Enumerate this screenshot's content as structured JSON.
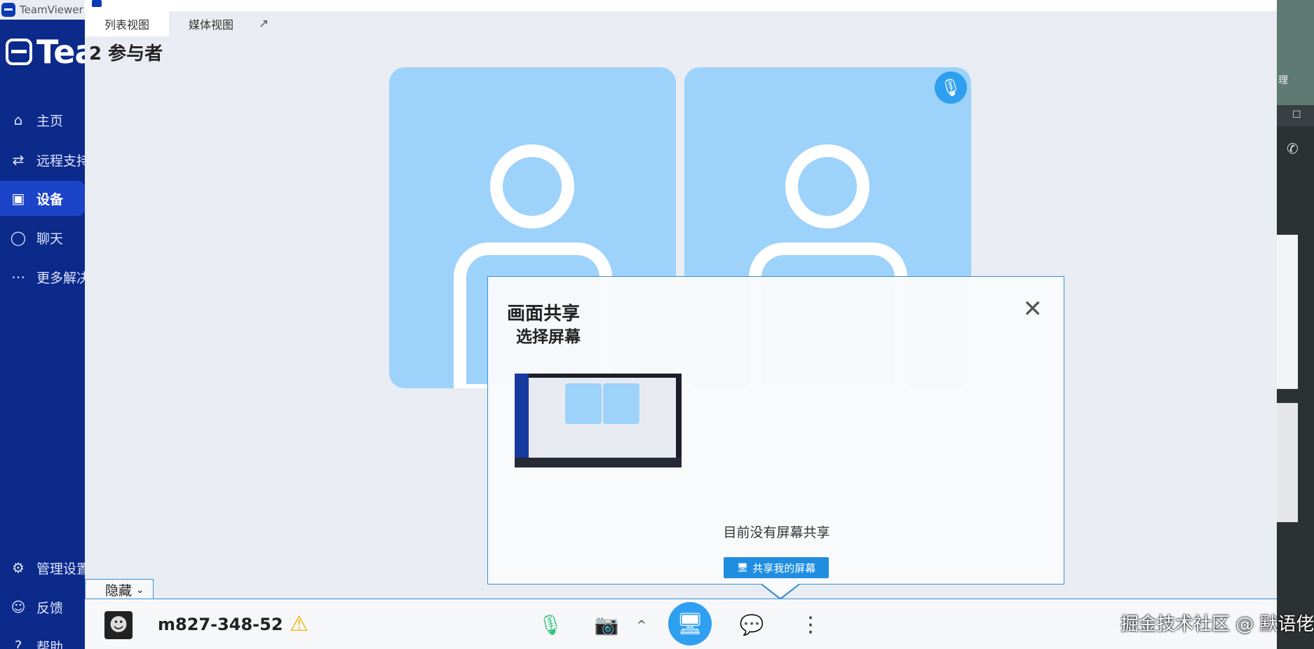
{
  "tv": {
    "title": "TeamViewer",
    "brand": "Tea",
    "nav": [
      {
        "icon": "⌂",
        "label": "主页"
      },
      {
        "icon": "⇄",
        "label": "远程支持"
      },
      {
        "icon": "▣",
        "label": "设备"
      },
      {
        "icon": "◯",
        "label": "聊天"
      },
      {
        "icon": "⋯",
        "label": "更多解决"
      },
      {
        "icon": "⚙",
        "label": "管理设置"
      },
      {
        "icon": "☺",
        "label": "反馈"
      },
      {
        "icon": "?",
        "label": "帮助"
      }
    ]
  },
  "meeting": {
    "tabs": [
      "列表视图",
      "媒体视图"
    ],
    "participants": "2 参与者",
    "hide_label": "隐藏",
    "meeting_id": "m827-348-52"
  },
  "modal": {
    "title": "画面共享",
    "subtitle": "选择屏幕",
    "no_share_text": "目前没有屏幕共享",
    "share_button": "共享我的屏幕"
  },
  "background": {
    "right_text": "理"
  },
  "watermark": "掘金技术社区 @ 默语佬",
  "icons": {
    "mic": "🎙",
    "camera_off": "📷",
    "screen": "🖥",
    "chat": "💬",
    "more": "⋮",
    "warning": "⚠",
    "close": "✕"
  },
  "colors": {
    "accent": "#2f9ff0",
    "sidebar": "#0b2a8a",
    "tile": "#9dd2fb",
    "mic_green": "#2ec27e",
    "camera_red": "#e8414b"
  }
}
